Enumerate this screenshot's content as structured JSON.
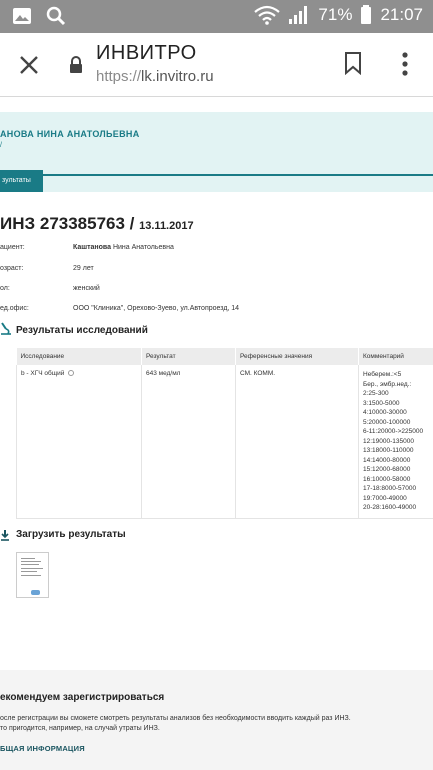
{
  "status_bar": {
    "battery_percent": "71%",
    "time": "21:07",
    "icons": [
      "gallery-icon",
      "search-icon",
      "wifi-icon",
      "signal-icon",
      "battery-icon"
    ]
  },
  "browser": {
    "page_title": "ИНВИТРО",
    "url_protocol": "https://",
    "url_host": "lk.invitro.ru"
  },
  "user": {
    "name": "АНОВА НИНА АНАТОЛЬЕВНА",
    "sub": "/"
  },
  "tabs": [
    {
      "label": "зультаты",
      "active": true
    }
  ],
  "order": {
    "number": "ИНЗ 273385763 /",
    "date": "13.11.2017"
  },
  "patient_info": [
    {
      "label": "ациент:",
      "value_bold": "Каштанова",
      "value": " Нина Анатольевна"
    },
    {
      "label": "озраст:",
      "value_bold": "",
      "value": "29 лет"
    },
    {
      "label": "ол:",
      "value_bold": "",
      "value": "женский"
    },
    {
      "label": "ед.офис:",
      "value_bold": "",
      "value": "ООО \"Клиника\", Орехово-Зуево, ул.Автопроезд, 14"
    }
  ],
  "results_section": {
    "title": "Результаты исследований",
    "columns": [
      "Исследование",
      "Результат",
      "Референсные значения",
      "Комментарий"
    ],
    "rows": [
      {
        "test": "b - ХГЧ общий",
        "result": "643 мед/мл",
        "reference": "СМ. КОММ.",
        "comments": [
          "Неберем.:<5",
          "Бер., эмбр.нед.:",
          "2:25-300",
          "3:1500-5000",
          "4:10000-30000",
          "5:20000-100000",
          "6-11:20000->225000",
          "12:19000-135000",
          "13:18000-110000",
          "14:14000-80000",
          "15:12000-68000",
          "16:10000-58000",
          "17-18:8000-57000",
          "19:7000-49000",
          "20-28:1600-49000"
        ]
      }
    ]
  },
  "download_section": {
    "title": "Загрузить результаты"
  },
  "footer": {
    "title": "екомендуем зарегистрироваться",
    "line1": "осле регистрации вы сможете смотреть результаты анализов без необходимости вводить каждый раз ИНЗ.",
    "line2": "то пригодится, например, на случай утраты ИНЗ.",
    "link": "БЩАЯ ИНФОРМАЦИЯ"
  },
  "colors": {
    "accent": "#1a7b86",
    "band_bg": "#e2f3f3",
    "status_bar_bg": "#8f8f8f"
  }
}
